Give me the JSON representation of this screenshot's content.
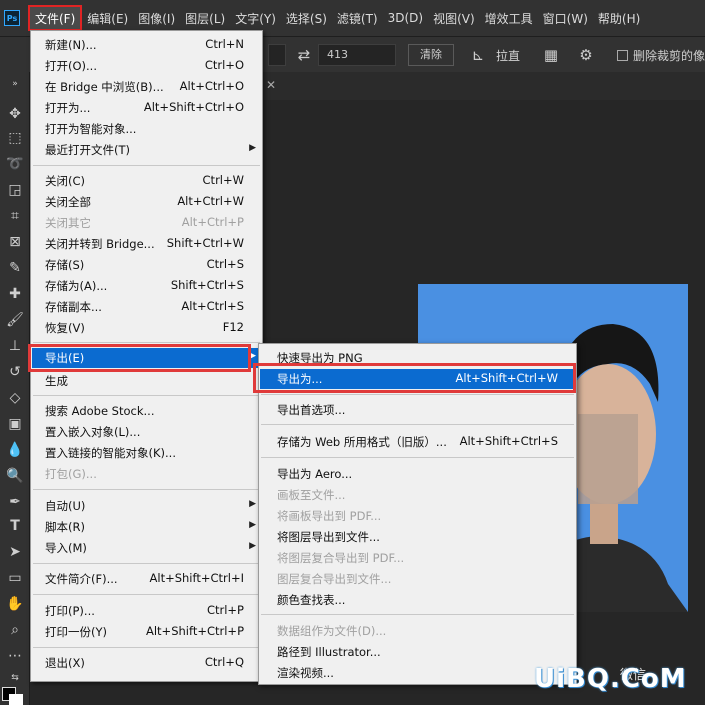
{
  "app": {
    "logo": "Ps"
  },
  "menubar": {
    "items": [
      "文件(F)",
      "编辑(E)",
      "图像(I)",
      "图层(L)",
      "文字(Y)",
      "选择(S)",
      "滤镜(T)",
      "3D(D)",
      "视图(V)",
      "增效工具",
      "窗口(W)",
      "帮助(H)"
    ]
  },
  "options": {
    "height_value": "413",
    "clear_label": "清除",
    "straighten_label": "拉直",
    "delete_cropped_label": "删除裁剪的像素"
  },
  "file_menu": [
    {
      "label": "新建(N)...",
      "shortcut": "Ctrl+N"
    },
    {
      "label": "打开(O)...",
      "shortcut": "Ctrl+O"
    },
    {
      "label": "在 Bridge 中浏览(B)...",
      "shortcut": "Alt+Ctrl+O"
    },
    {
      "label": "打开为...",
      "shortcut": "Alt+Shift+Ctrl+O"
    },
    {
      "label": "打开为智能对象...",
      "shortcut": ""
    },
    {
      "label": "最近打开文件(T)",
      "shortcut": ""
    },
    {
      "label": "关闭(C)",
      "shortcut": "Ctrl+W"
    },
    {
      "label": "关闭全部",
      "shortcut": "Alt+Ctrl+W"
    },
    {
      "label": "关闭其它",
      "shortcut": "Alt+Ctrl+P"
    },
    {
      "label": "关闭并转到 Bridge...",
      "shortcut": "Shift+Ctrl+W"
    },
    {
      "label": "存储(S)",
      "shortcut": "Ctrl+S"
    },
    {
      "label": "存储为(A)...",
      "shortcut": "Shift+Ctrl+S"
    },
    {
      "label": "存储副本...",
      "shortcut": "Alt+Ctrl+S"
    },
    {
      "label": "恢复(V)",
      "shortcut": "F12"
    },
    {
      "label": "导出(E)",
      "shortcut": ""
    },
    {
      "label": "生成",
      "shortcut": ""
    },
    {
      "label": "搜索 Adobe Stock...",
      "shortcut": ""
    },
    {
      "label": "置入嵌入对象(L)...",
      "shortcut": ""
    },
    {
      "label": "置入链接的智能对象(K)...",
      "shortcut": ""
    },
    {
      "label": "打包(G)...",
      "shortcut": ""
    },
    {
      "label": "自动(U)",
      "shortcut": ""
    },
    {
      "label": "脚本(R)",
      "shortcut": ""
    },
    {
      "label": "导入(M)",
      "shortcut": ""
    },
    {
      "label": "文件简介(F)...",
      "shortcut": "Alt+Shift+Ctrl+I"
    },
    {
      "label": "打印(P)...",
      "shortcut": "Ctrl+P"
    },
    {
      "label": "打印一份(Y)",
      "shortcut": "Alt+Shift+Ctrl+P"
    },
    {
      "label": "退出(X)",
      "shortcut": "Ctrl+Q"
    }
  ],
  "export_menu": [
    {
      "label": "快速导出为 PNG",
      "shortcut": ""
    },
    {
      "label": "导出为...",
      "shortcut": "Alt+Shift+Ctrl+W"
    },
    {
      "label": "导出首选项...",
      "shortcut": ""
    },
    {
      "label": "存储为 Web 所用格式（旧版）...",
      "shortcut": "Alt+Shift+Ctrl+S"
    },
    {
      "label": "导出为 Aero...",
      "shortcut": ""
    },
    {
      "label": "画板至文件...",
      "shortcut": ""
    },
    {
      "label": "将画板导出到 PDF...",
      "shortcut": ""
    },
    {
      "label": "将图层导出到文件...",
      "shortcut": ""
    },
    {
      "label": "将图层复合导出到 PDF...",
      "shortcut": ""
    },
    {
      "label": "图层复合导出到文件...",
      "shortcut": ""
    },
    {
      "label": "颜色查找表...",
      "shortcut": ""
    },
    {
      "label": "数据组作为文件(D)...",
      "shortcut": ""
    },
    {
      "label": "路径到 Illustrator...",
      "shortcut": ""
    },
    {
      "label": "渲染视频...",
      "shortcut": ""
    }
  ],
  "watermark": {
    "text": "UiBQ.CoM",
    "wechat_label": "微信"
  }
}
